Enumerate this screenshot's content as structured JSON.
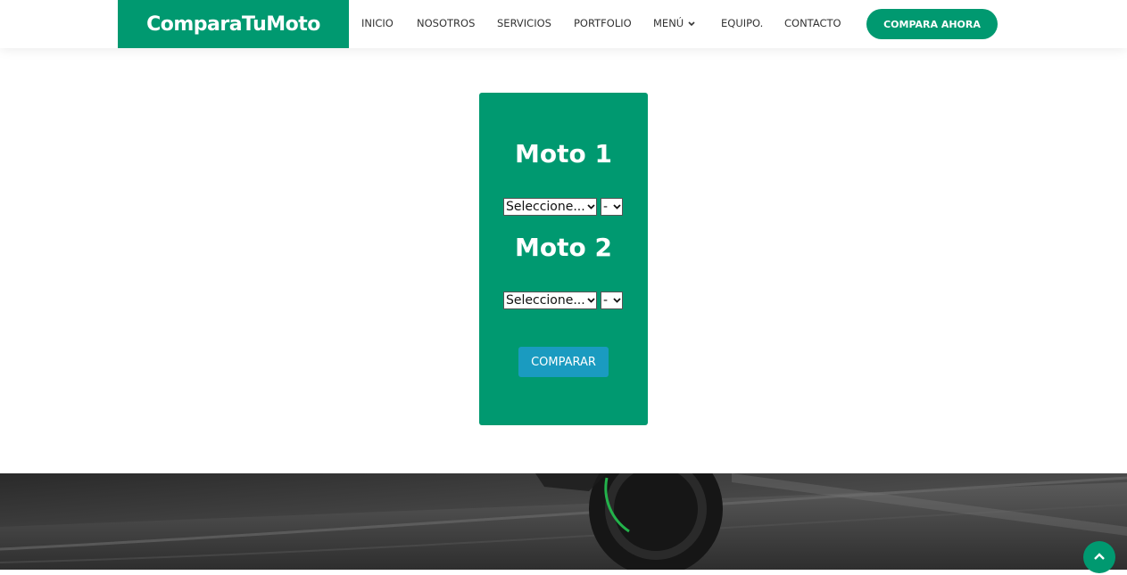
{
  "brand": {
    "name": "ComparaTuMoto",
    "color": "#009970"
  },
  "nav": {
    "items": [
      {
        "label": "INICIO"
      },
      {
        "label": "NOSOTROS"
      },
      {
        "label": "SERVICIOS"
      },
      {
        "label": "PORTFOLIO"
      },
      {
        "label": "MENÚ",
        "icon": "chevron-down-icon"
      },
      {
        "label": "EQUIPO."
      },
      {
        "label": "CONTACTO"
      }
    ],
    "cta_label": "COMPARA AHORA"
  },
  "comparator": {
    "moto1": {
      "title": "Moto 1",
      "brand_select": "Seleccione...",
      "model_select": "-"
    },
    "moto2": {
      "title": "Moto 2",
      "brand_select": "Seleccione...",
      "model_select": "-"
    },
    "button_label": "COMPARAR",
    "button_color": "#1a9bc0"
  },
  "banner": {
    "image": "motorcycle-road-photo"
  },
  "back_to_top": {
    "icon": "chevron-up-icon"
  }
}
